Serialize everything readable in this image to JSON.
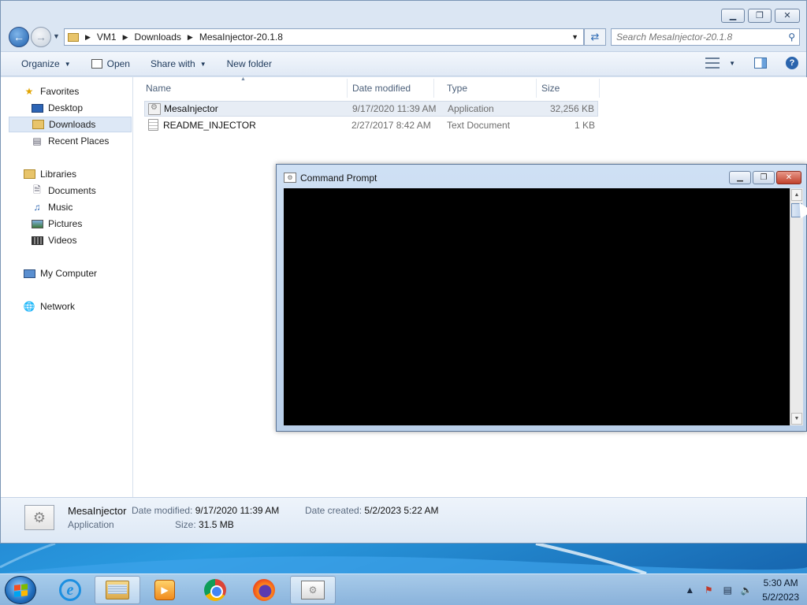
{
  "explorer": {
    "window_buttons": {
      "minimize": "▁",
      "maximize": "❐",
      "close": "✕"
    },
    "address": {
      "segments": [
        "VM1",
        "Downloads",
        "MesaInjector-20.1.8"
      ]
    },
    "search": {
      "placeholder": "Search MesaInjector-20.1.8"
    },
    "toolbar": {
      "organize": "Organize",
      "open": "Open",
      "share_with": "Share with",
      "new_folder": "New folder"
    },
    "nav": {
      "favorites": "Favorites",
      "desktop": "Desktop",
      "downloads": "Downloads",
      "recent_places": "Recent Places",
      "libraries": "Libraries",
      "documents": "Documents",
      "music": "Music",
      "pictures": "Pictures",
      "videos": "Videos",
      "my_computer": "My Computer",
      "network": "Network"
    },
    "columns": {
      "name": "Name",
      "date": "Date modified",
      "type": "Type",
      "size": "Size"
    },
    "files": [
      {
        "name": "MesaInjector",
        "date": "9/17/2020 11:39 AM",
        "type": "Application",
        "size": "32,256 KB",
        "icon": "application-icon"
      },
      {
        "name": "README_INJECTOR",
        "date": "2/27/2017 8:42 AM",
        "type": "Text Document",
        "size": "1 KB",
        "icon": "text-document-icon"
      }
    ],
    "details": {
      "name": "MesaInjector",
      "type": "Application",
      "modified_label": "Date modified:",
      "modified_value": "9/17/2020 11:39 AM",
      "created_label": "Date created:",
      "created_value": "5/2/2023 5:22 AM",
      "size_label": "Size:",
      "size_value": "31.5 MB"
    }
  },
  "cmd": {
    "title": "Command Prompt",
    "console_bg": "#000000"
  },
  "taskbar": {
    "apps": [
      "internet-explorer-icon",
      "windows-explorer-icon",
      "windows-media-player-icon",
      "chrome-icon",
      "firefox-icon",
      "command-prompt-icon"
    ],
    "clock": {
      "time": "5:30 AM",
      "date": "5/2/2023"
    }
  }
}
